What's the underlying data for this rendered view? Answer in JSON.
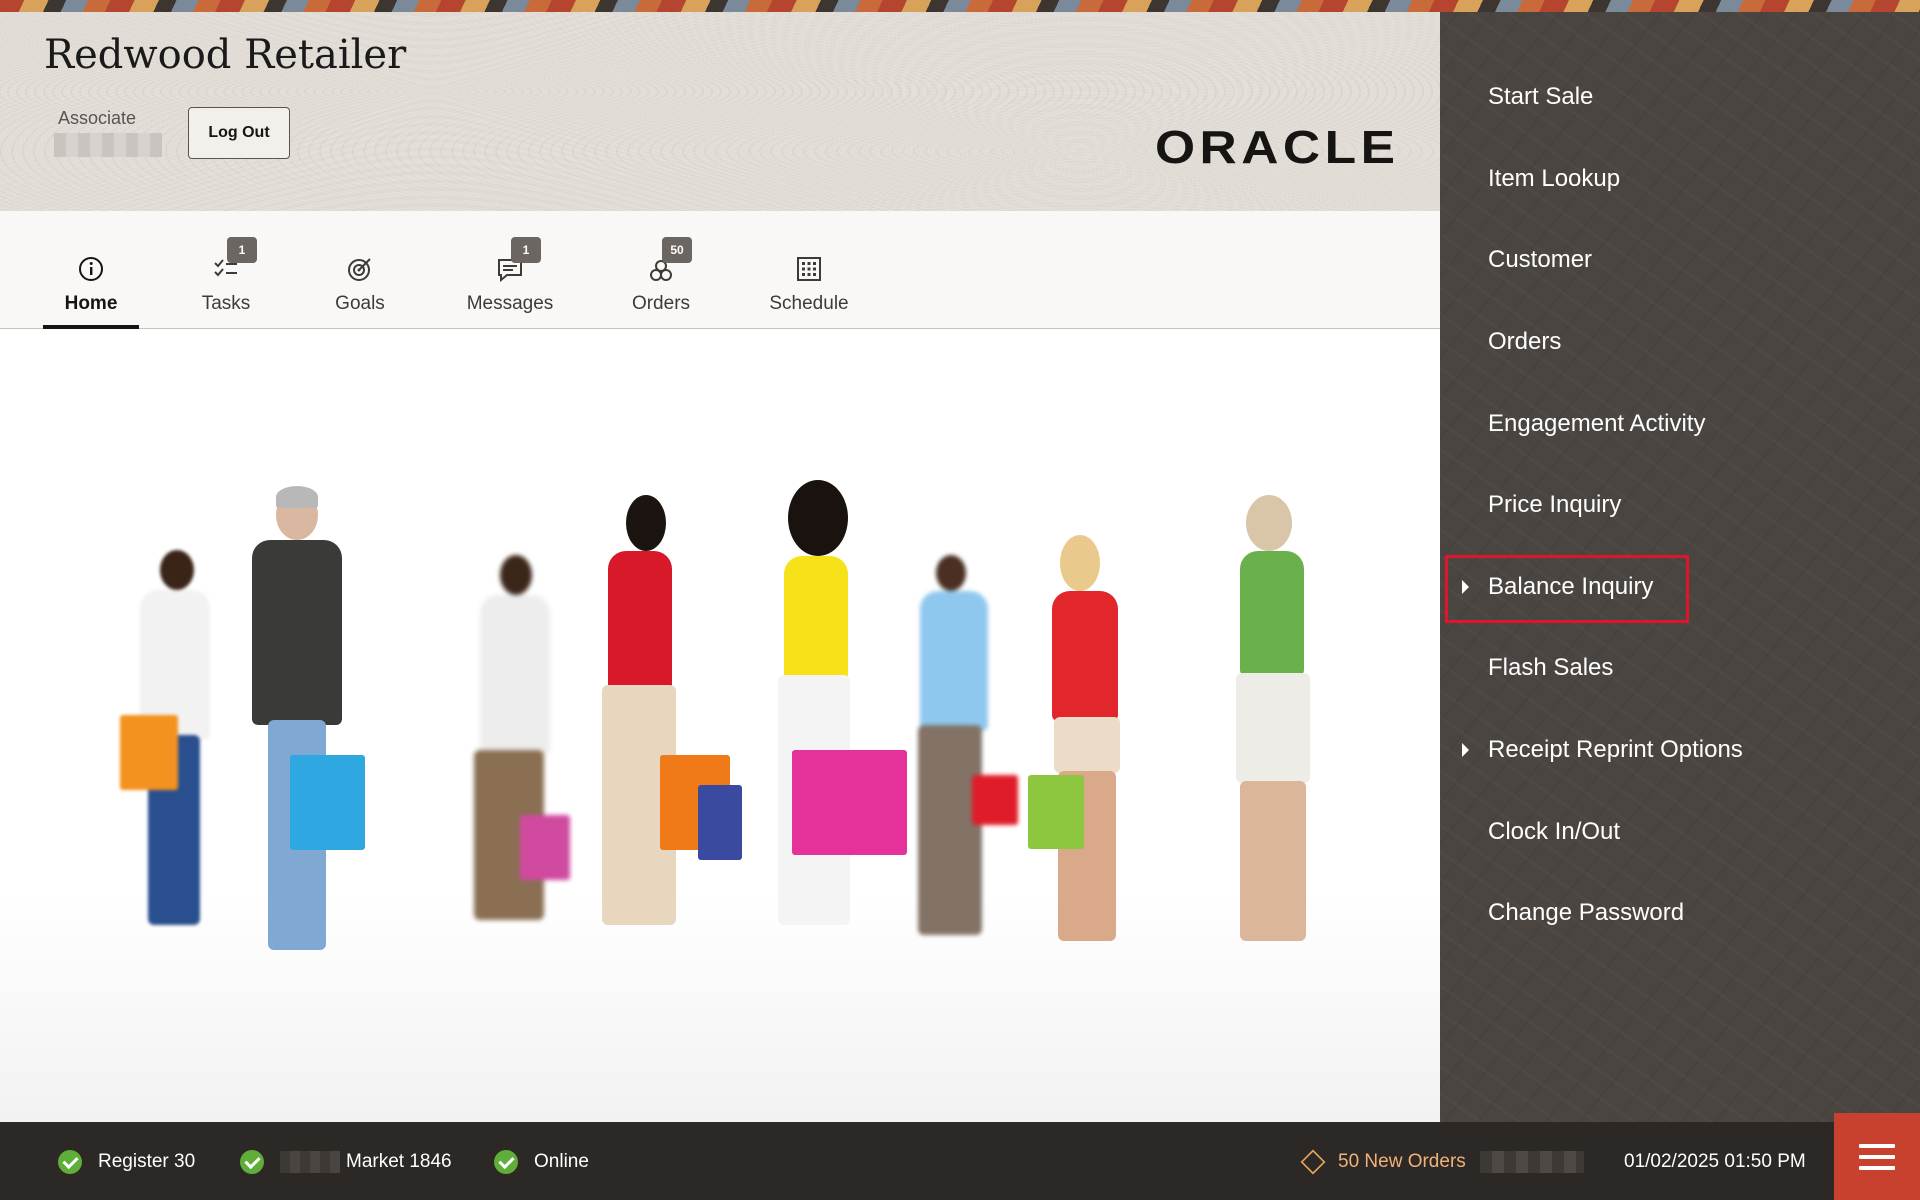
{
  "app": {
    "title": "Redwood Retailer",
    "associate_label": "Associate",
    "logout_label": "Log Out",
    "brand_logo": "ORACLE"
  },
  "tabs": [
    {
      "label": "Home",
      "icon": "info-icon",
      "active": true
    },
    {
      "label": "Tasks",
      "icon": "tasks-icon",
      "badge": "1"
    },
    {
      "label": "Goals",
      "icon": "target-icon"
    },
    {
      "label": "Messages",
      "icon": "message-icon",
      "badge": "1"
    },
    {
      "label": "Orders",
      "icon": "orders-icon",
      "badge": "50"
    },
    {
      "label": "Schedule",
      "icon": "calendar-icon"
    }
  ],
  "menu": {
    "items": [
      {
        "label": "Start Sale"
      },
      {
        "label": "Item Lookup"
      },
      {
        "label": "Customer"
      },
      {
        "label": "Orders"
      },
      {
        "label": "Engagement Activity"
      },
      {
        "label": "Price Inquiry"
      },
      {
        "label": "Balance Inquiry",
        "expandable": true,
        "highlighted": true
      },
      {
        "label": "Flash Sales"
      },
      {
        "label": "Receipt Reprint Options",
        "expandable": true
      },
      {
        "label": "Clock In/Out"
      },
      {
        "label": "Change Password"
      }
    ]
  },
  "status": {
    "register": "Register 30",
    "store": "Market 1846",
    "connection": "Online",
    "new_orders": "50 New Orders",
    "datetime": "01/02/2025 01:50 PM"
  },
  "colors": {
    "menu_bg": "#4a4541",
    "status_bg": "#2b2825",
    "check_green": "#5fae3a",
    "orders_accent": "#f0b27a",
    "hamburger_red": "#c8412f",
    "highlight_red": "#e0142a"
  }
}
